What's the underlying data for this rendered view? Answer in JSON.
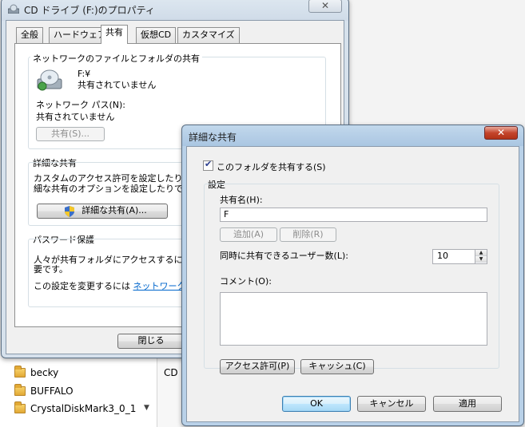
{
  "background": {
    "folders": [
      "becky",
      "BUFFALO",
      "CrystalDiskMark3_0_1"
    ],
    "right_pane_label": "CD"
  },
  "properties_window": {
    "title": "CD ドライブ (F:)のプロパティ",
    "close_glyph": "✕",
    "tabs": [
      "全般",
      "ハードウェア",
      "共有",
      "仮想CD",
      "カスタマイズ"
    ],
    "active_tab": "共有",
    "network_group": {
      "title": "ネットワークのファイルとフォルダの共有",
      "drive_name": "F:¥",
      "drive_status": "共有されていません",
      "network_path_label": "ネットワーク パス(N):",
      "network_path_value": "共有されていません",
      "share_button": "共有(S)..."
    },
    "advanced_group": {
      "title": "詳細な共有",
      "description_line1": "カスタムのアクセス許可を設定したり、複",
      "description_line2": "細な共有のオプションを設定したりできま",
      "advanced_button": "詳細な共有(A)..."
    },
    "password_group": {
      "title": "パスワード保護",
      "line1": "人々が共有フォルダにアクセスするには、",
      "line2": "要です。",
      "change_prefix": "この設定を変更するには ",
      "change_link": "ネットワークと共"
    },
    "close_button": "閉じる"
  },
  "advanced_dialog": {
    "title": "詳細な共有",
    "close_glyph": "✕",
    "share_checkbox_label": "このフォルダを共有する(S)",
    "share_checked": true,
    "settings_label": "設定",
    "share_name_label": "共有名(H):",
    "share_name_value": "F",
    "add_button": "追加(A)",
    "remove_button": "削除(R)",
    "user_limit_label": "同時に共有できるユーザー数(L):",
    "user_limit_value": "10",
    "comment_label": "コメント(O):",
    "comment_value": "",
    "permissions_button": "アクセス許可(P)",
    "cache_button": "キャッシュ(C)",
    "ok_button": "OK",
    "cancel_button": "キャンセル",
    "apply_button": "適用"
  }
}
